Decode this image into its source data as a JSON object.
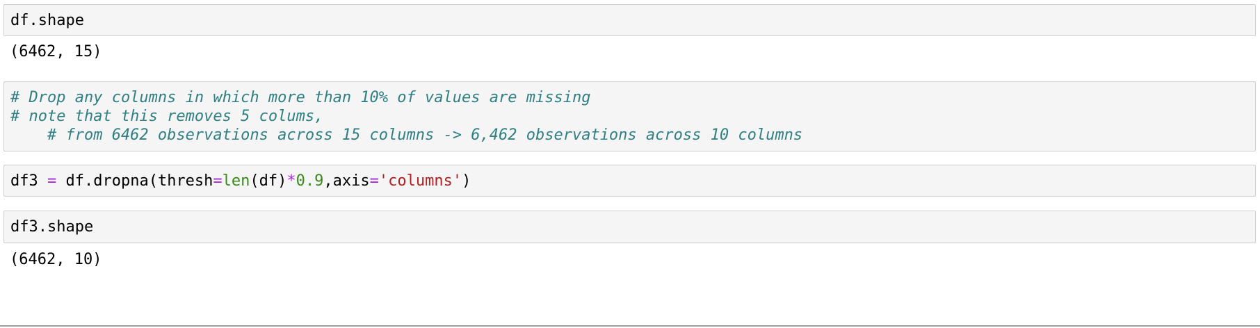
{
  "cells": [
    {
      "input": "df.shape",
      "output": "(6462, 15)"
    },
    {
      "comment_lines": [
        "# Drop any columns in which more than 10% of values are missing",
        "# note that this removes 5 colums,",
        "    # from 6462 observations across 15 columns -> 6,462 observations across 10 columns"
      ]
    },
    {
      "tokens": {
        "var": "df3",
        "assign": "=",
        "call": "df.dropna(thresh",
        "eq1": "=",
        "len_fn": "len",
        "len_arg": "(df)",
        "mul": "*",
        "factor": "0.9",
        "sep": ",axis",
        "eq2": "=",
        "axis_value": "'columns'",
        "close": ")"
      }
    },
    {
      "input": "df3.shape",
      "output": "(6462, 10)"
    }
  ],
  "colors": {
    "cell_background": "#f5f5f5",
    "cell_border": "#cfcfcf",
    "comment": "#2f7f83",
    "operator": "#a82bd9",
    "builtin_and_number": "#3a8a1a",
    "string": "#b22222"
  }
}
